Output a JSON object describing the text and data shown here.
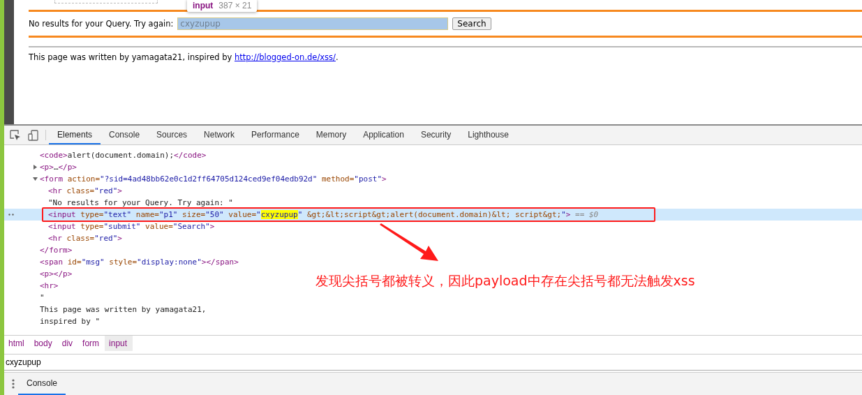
{
  "page": {
    "tooltip": {
      "tag": "input",
      "size": "387 × 21"
    },
    "form": {
      "label": "No results for your Query. Try again:",
      "value": "cxyzupup",
      "button": "Search"
    },
    "footer": {
      "before": "This page was written by yamagata21, inspired by ",
      "link": "http://blogged-on.de/xss/",
      "after": "."
    }
  },
  "devtools": {
    "tabs": [
      {
        "label": "Elements",
        "selected": true
      },
      {
        "label": "Console",
        "selected": false
      },
      {
        "label": "Sources",
        "selected": false
      },
      {
        "label": "Network",
        "selected": false
      },
      {
        "label": "Performance",
        "selected": false
      },
      {
        "label": "Memory",
        "selected": false
      },
      {
        "label": "Application",
        "selected": false
      },
      {
        "label": "Security",
        "selected": false
      },
      {
        "label": "Lighthouse",
        "selected": false
      }
    ],
    "dom_tree": [
      {
        "selected": false,
        "segments": [
          {
            "kind": "tag",
            "text": "<code>"
          },
          {
            "kind": "text",
            "text": "alert(document.domain);"
          },
          {
            "kind": "tag",
            "text": "</code>"
          }
        ]
      },
      {
        "selected": false,
        "expanded": false,
        "segments": [
          {
            "kind": "tag",
            "text": "<p>"
          },
          {
            "kind": "text",
            "text": "…"
          },
          {
            "kind": "tag",
            "text": "</p>"
          }
        ]
      },
      {
        "selected": false,
        "expanded": true,
        "segments": [
          {
            "kind": "tag",
            "text": "<form"
          },
          {
            "kind": "attr",
            "text": " action="
          },
          {
            "kind": "value",
            "text": "\"?sid=4ad48bb62e0c1d2ff64705d124ced9ef04edb92d\""
          },
          {
            "kind": "attr",
            "text": " method="
          },
          {
            "kind": "value",
            "text": "\"post\""
          },
          {
            "kind": "tag",
            "text": ">"
          }
        ],
        "children": [
          {
            "selected": false,
            "segments": [
              {
                "kind": "tag",
                "text": "<hr"
              },
              {
                "kind": "attr",
                "text": " class="
              },
              {
                "kind": "value",
                "text": "\"red\""
              },
              {
                "kind": "tag",
                "text": ">"
              }
            ]
          },
          {
            "selected": false,
            "segments": [
              {
                "kind": "text",
                "text": "\"No results for your Query. Try again: \""
              }
            ]
          },
          {
            "selected": true,
            "boxed": true,
            "segments": [
              {
                "kind": "tag",
                "text": "<input"
              },
              {
                "kind": "attr",
                "text": " type="
              },
              {
                "kind": "value",
                "text": "\"text\""
              },
              {
                "kind": "attr",
                "text": " name="
              },
              {
                "kind": "value",
                "text": "\"p1\""
              },
              {
                "kind": "attr",
                "text": " size="
              },
              {
                "kind": "value",
                "text": "\"50\""
              },
              {
                "kind": "attr",
                "text": " value="
              },
              {
                "kind": "value",
                "text": "\""
              },
              {
                "kind": "match",
                "text": "cxyzupup"
              },
              {
                "kind": "value",
                "text": "\""
              },
              {
                "kind": "attr",
                "text": " &gt;&lt;script&gt;alert(document.domain)&lt; script&gt;"
              },
              {
                "kind": "value",
                "text": "\""
              },
              {
                "kind": "tag",
                "text": ">"
              },
              {
                "kind": "note",
                "text": " == $0"
              }
            ]
          },
          {
            "selected": false,
            "segments": [
              {
                "kind": "tag",
                "text": "<input"
              },
              {
                "kind": "attr",
                "text": " type="
              },
              {
                "kind": "value",
                "text": "\"submit\""
              },
              {
                "kind": "attr",
                "text": " value="
              },
              {
                "kind": "value",
                "text": "\"Search\""
              },
              {
                "kind": "tag",
                "text": ">"
              }
            ]
          },
          {
            "selected": false,
            "segments": [
              {
                "kind": "tag",
                "text": "<hr"
              },
              {
                "kind": "attr",
                "text": " class="
              },
              {
                "kind": "value",
                "text": "\"red\""
              },
              {
                "kind": "tag",
                "text": ">"
              }
            ]
          }
        ],
        "closing": [
          {
            "kind": "tag",
            "text": "</form>"
          }
        ]
      },
      {
        "selected": false,
        "segments": [
          {
            "kind": "tag",
            "text": "<span"
          },
          {
            "kind": "attr",
            "text": " id="
          },
          {
            "kind": "value",
            "text": "\"msg\""
          },
          {
            "kind": "attr",
            "text": " style="
          },
          {
            "kind": "value",
            "text": "\"display:none\""
          },
          {
            "kind": "tag",
            "text": "></span>"
          }
        ]
      },
      {
        "selected": false,
        "segments": [
          {
            "kind": "tag",
            "text": "<p></p>"
          }
        ]
      },
      {
        "selected": false,
        "segments": [
          {
            "kind": "tag",
            "text": "<hr>"
          }
        ]
      },
      {
        "selected": false,
        "segments": [
          {
            "kind": "text",
            "text": "\""
          }
        ]
      },
      {
        "selected": false,
        "segments": [
          {
            "kind": "text",
            "text": "This page was written by yamagata21,"
          }
        ]
      },
      {
        "selected": false,
        "segments": [
          {
            "kind": "text",
            "text": "inspired by \""
          }
        ]
      }
    ],
    "breadcrumbs": [
      {
        "label": "html",
        "selected": false
      },
      {
        "label": "body",
        "selected": false
      },
      {
        "label": "div",
        "selected": false
      },
      {
        "label": "form",
        "selected": false
      },
      {
        "label": "input",
        "selected": true
      }
    ],
    "styles_value": "cxyzupup",
    "drawer_tabs": [
      {
        "label": "Console",
        "selected": true
      }
    ]
  },
  "annotation": {
    "text": "发现尖括号都被转义，因此payload中存在尖括号都无法触发xss"
  }
}
